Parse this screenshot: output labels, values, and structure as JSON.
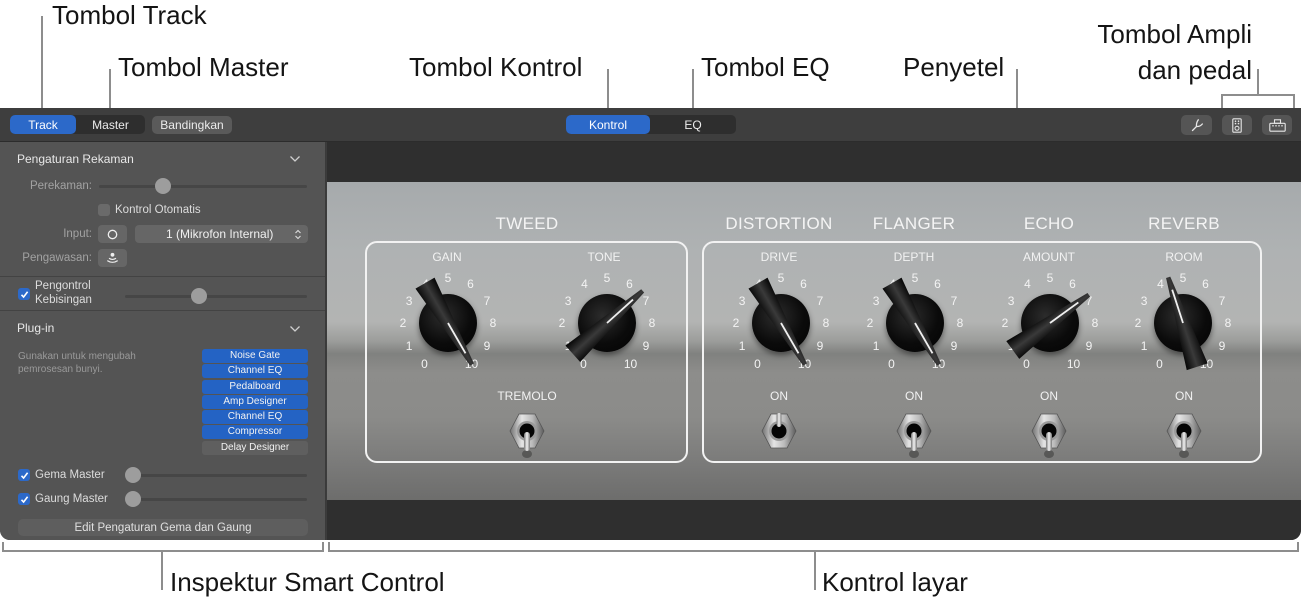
{
  "callouts": {
    "track_button": "Tombol Track",
    "master_button": "Tombol Master",
    "controls_button": "Tombol Kontrol",
    "eq_button": "Tombol EQ",
    "tuner": "Penyetel",
    "amp_pedal_line1": "Tombol Ampli",
    "amp_pedal_line2": "dan pedal",
    "inspector": "Inspektur Smart Control",
    "screen_controls": "Kontrol layar"
  },
  "toolbar": {
    "view_tabs": [
      {
        "label": "Track",
        "selected": true
      },
      {
        "label": "Master",
        "selected": false
      }
    ],
    "compare_label": "Bandingkan",
    "mode_tabs": [
      {
        "label": "Kontrol",
        "selected": true
      },
      {
        "label": "EQ",
        "selected": false
      }
    ],
    "right_icons": [
      "tuner-icon",
      "amp-icon",
      "pedalboard-icon"
    ]
  },
  "inspector": {
    "recording": {
      "title": "Pengaturan Rekaman",
      "level_label": "Perekaman:",
      "level": 0.29,
      "auto_control_label": "Kontrol Otomatis",
      "auto_control_checked": false,
      "input_label": "Input:",
      "input_value": "1 (Mikrofon Internal)",
      "monitoring_label": "Pengawasan:"
    },
    "noise_gate": {
      "label": "Pengontrol Kebisingan",
      "checked": true,
      "level": 0.4
    },
    "plugins": {
      "title": "Plug-in",
      "description": "Gunakan untuk mengubah pemrosesan bunyi.",
      "items": [
        {
          "name": "Noise Gate",
          "active": true
        },
        {
          "name": "Channel EQ",
          "active": true
        },
        {
          "name": "Pedalboard",
          "active": true
        },
        {
          "name": "Amp Designer",
          "active": true
        },
        {
          "name": "Channel EQ",
          "active": true
        },
        {
          "name": "Compressor",
          "active": true
        },
        {
          "name": "Delay Designer",
          "active": false
        }
      ]
    },
    "master_echo": {
      "label": "Gema Master",
      "checked": true,
      "level": 0
    },
    "master_reverb": {
      "label": "Gaung Master",
      "checked": true,
      "level": 0
    },
    "edit_button": "Edit Pengaturan Gema dan Gaung"
  },
  "amp": {
    "scale_labels": [
      "0",
      "1",
      "2",
      "3",
      "4",
      "5",
      "6",
      "7",
      "8",
      "9",
      "10"
    ],
    "sections": [
      {
        "title": "TWEED"
      },
      {
        "title": "DISTORTION"
      },
      {
        "title": "FLANGER"
      },
      {
        "title": "ECHO"
      },
      {
        "title": "REVERB"
      }
    ],
    "knobs": [
      {
        "label": "GAIN",
        "value": 10
      },
      {
        "label": "TONE",
        "value": 6.6
      },
      {
        "label": "DRIVE",
        "value": 10
      },
      {
        "label": "DEPTH",
        "value": 10
      },
      {
        "label": "AMOUNT",
        "value": 6.8
      },
      {
        "label": "ROOM",
        "value": 4.4
      }
    ],
    "switches": [
      {
        "label": "TREMOLO",
        "position": "down"
      },
      {
        "label": "ON",
        "position": "up"
      },
      {
        "label": "ON",
        "position": "down"
      },
      {
        "label": "ON",
        "position": "down"
      },
      {
        "label": "ON",
        "position": "down"
      }
    ]
  },
  "colors": {
    "accent": "#2c69c9",
    "plugin_active": "#2463c4",
    "inspector_bg": "#545454",
    "toolbar_bg": "#3e3e3e",
    "amp_label": "#f4f4f4"
  }
}
